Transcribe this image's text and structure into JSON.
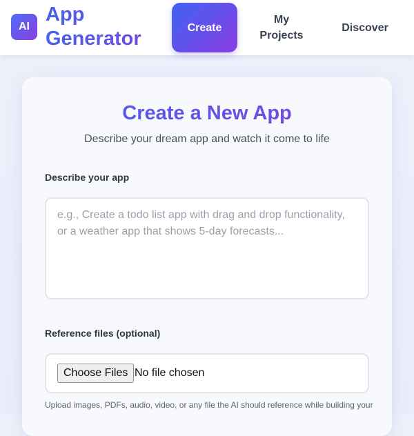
{
  "header": {
    "logo_text": "AI",
    "brand_title": "App Generator",
    "nav": [
      {
        "label": "Create",
        "active": true
      },
      {
        "label": "My Projects",
        "active": false
      },
      {
        "label": "Discover",
        "active": false
      }
    ]
  },
  "main": {
    "title": "Create a New App",
    "subtitle": "Describe your dream app and watch it come to life",
    "description": {
      "label": "Describe your app",
      "value": "",
      "placeholder": "e.g., Create a todo list app with drag and drop functionality, or a weather app that shows 5-day forecasts..."
    },
    "files": {
      "label": "Reference files (optional)",
      "button_label": "Choose Files",
      "status": "No file chosen",
      "helper": "Upload images, PDFs, audio, video, or any file the AI should reference while building your"
    }
  },
  "colors": {
    "accent_start": "#3f63f2",
    "accent_end": "#8b3de3",
    "background": "#eef1fb",
    "card": "#f8f9fc"
  },
  "icons": {
    "logo": "ai-logo-icon"
  }
}
